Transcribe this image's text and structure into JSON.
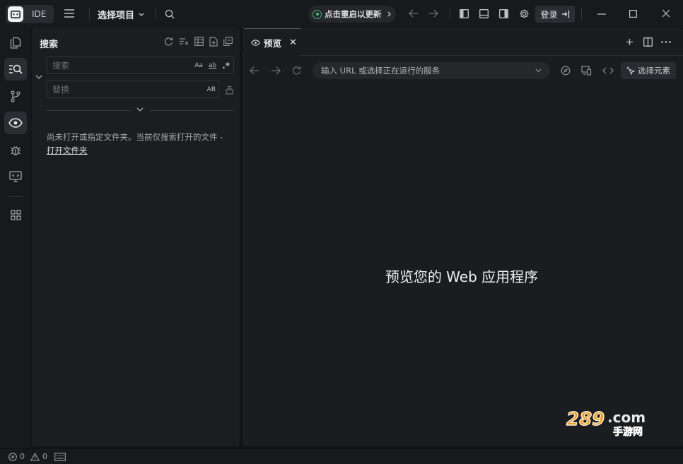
{
  "titlebar": {
    "app_label": "IDE",
    "project_selector": "选择项目",
    "update_button": "点击重启以更新",
    "login_button": "登录"
  },
  "activity_bar": {
    "items": [
      {
        "name": "explorer",
        "icon": "files-icon"
      },
      {
        "name": "search",
        "icon": "search-list-icon",
        "active": true
      },
      {
        "name": "source-control",
        "icon": "git-branch-icon"
      },
      {
        "name": "preview",
        "icon": "eye-icon"
      },
      {
        "name": "debug",
        "icon": "bug-icon"
      },
      {
        "name": "remote",
        "icon": "monitor-code-icon"
      },
      {
        "name": "extensions",
        "icon": "grid-icon"
      }
    ]
  },
  "search_panel": {
    "title": "搜索",
    "search_placeholder": "搜索",
    "replace_placeholder": "替换",
    "match_case_label": "Aa",
    "whole_word_label": "ab",
    "regex_label": ".*",
    "preserve_case_label": "AB",
    "hint_text": "尚未打开或指定文件夹。当前仅搜索打开的文件 -",
    "open_folder_link": "打开文件夹"
  },
  "preview_panel": {
    "tab_label": "预览",
    "tab_close": "✕",
    "url_placeholder": "输入 URL 或选择正在运行的服务",
    "select_element_label": "选择元素",
    "empty_message": "预览您的 Web 应用程序"
  },
  "status_bar": {
    "errors_count": "0",
    "warnings_count": "0"
  },
  "watermark": {
    "text_top": "289.com",
    "text_bottom": "手游网"
  },
  "colors": {
    "background": "#121316",
    "panel": "#1c1d20",
    "accent_green": "#3fb27f",
    "watermark_orange": "#f4a21c"
  }
}
